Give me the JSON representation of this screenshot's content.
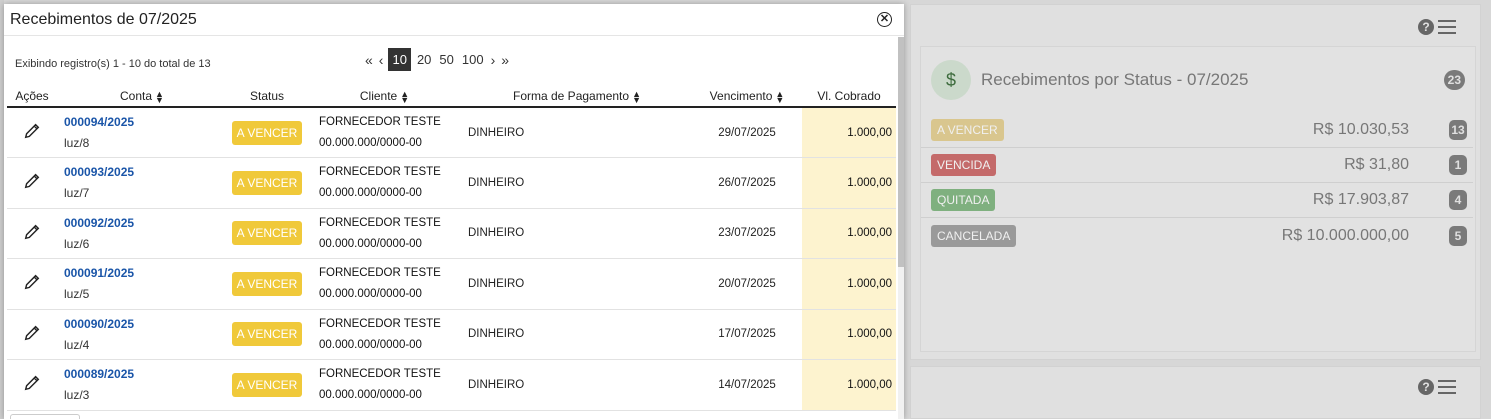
{
  "modal": {
    "title": "Recebimentos de 07/2025",
    "close_icon": "close-circle-icon",
    "records_text": "Exibindo registro(s) 1 - 10 do total de 13",
    "pagination": {
      "first": "«",
      "prev": "‹",
      "page_sizes": [
        "10",
        "20",
        "50",
        "100"
      ],
      "active_page_size": "10",
      "next": "›",
      "last": "»"
    },
    "table": {
      "headers": {
        "acoes": "Ações",
        "conta": "Conta",
        "status": "Status",
        "cliente": "Cliente",
        "forma": "Forma de Pagamento",
        "vencimento": "Vencimento",
        "valor": "Vl. Cobrado"
      },
      "rows": [
        {
          "conta": "000094/2025",
          "ref": "luz/8",
          "status": "A VENCER",
          "cliente": "FORNECEDOR TESTE",
          "doc": "00.000.000/0000-00",
          "forma": "DINHEIRO",
          "vencimento": "29/07/2025",
          "valor": "1.000,00"
        },
        {
          "conta": "000093/2025",
          "ref": "luz/7",
          "status": "A VENCER",
          "cliente": "FORNECEDOR TESTE",
          "doc": "00.000.000/0000-00",
          "forma": "DINHEIRO",
          "vencimento": "26/07/2025",
          "valor": "1.000,00"
        },
        {
          "conta": "000092/2025",
          "ref": "luz/6",
          "status": "A VENCER",
          "cliente": "FORNECEDOR TESTE",
          "doc": "00.000.000/0000-00",
          "forma": "DINHEIRO",
          "vencimento": "23/07/2025",
          "valor": "1.000,00"
        },
        {
          "conta": "000091/2025",
          "ref": "luz/5",
          "status": "A VENCER",
          "cliente": "FORNECEDOR TESTE",
          "doc": "00.000.000/0000-00",
          "forma": "DINHEIRO",
          "vencimento": "20/07/2025",
          "valor": "1.000,00"
        },
        {
          "conta": "000090/2025",
          "ref": "luz/4",
          "status": "A VENCER",
          "cliente": "FORNECEDOR TESTE",
          "doc": "00.000.000/0000-00",
          "forma": "DINHEIRO",
          "vencimento": "17/07/2025",
          "valor": "1.000,00"
        },
        {
          "conta": "000089/2025",
          "ref": "luz/3",
          "status": "A VENCER",
          "cliente": "FORNECEDOR TESTE",
          "doc": "00.000.000/0000-00",
          "forma": "DINHEIRO",
          "vencimento": "14/07/2025",
          "valor": "1.000,00"
        }
      ]
    }
  },
  "dashboard": {
    "card": {
      "title": "Recebimentos por Status - 07/2025",
      "total_count": "23",
      "icon": "money-bag-icon",
      "rows": [
        {
          "label": "A VENCER",
          "amount": "R$ 10.030,53",
          "count": "13",
          "color": "#f0c93a"
        },
        {
          "label": "VENCIDA",
          "amount": "R$ 31,80",
          "count": "1",
          "color": "#d9534f"
        },
        {
          "label": "QUITADA",
          "amount": "R$ 17.903,87",
          "count": "4",
          "color": "#5cb85c"
        },
        {
          "label": "CANCELADA",
          "amount": "R$ 10.000.000,00",
          "count": "5",
          "color": "#999999"
        }
      ]
    },
    "toolbar_icons": [
      "help-icon",
      "menu-icon"
    ]
  },
  "colors": {
    "status_a_vencer": "#f0c93a",
    "link": "#1a55a8",
    "value_column_bg": "#fdf3cf"
  }
}
